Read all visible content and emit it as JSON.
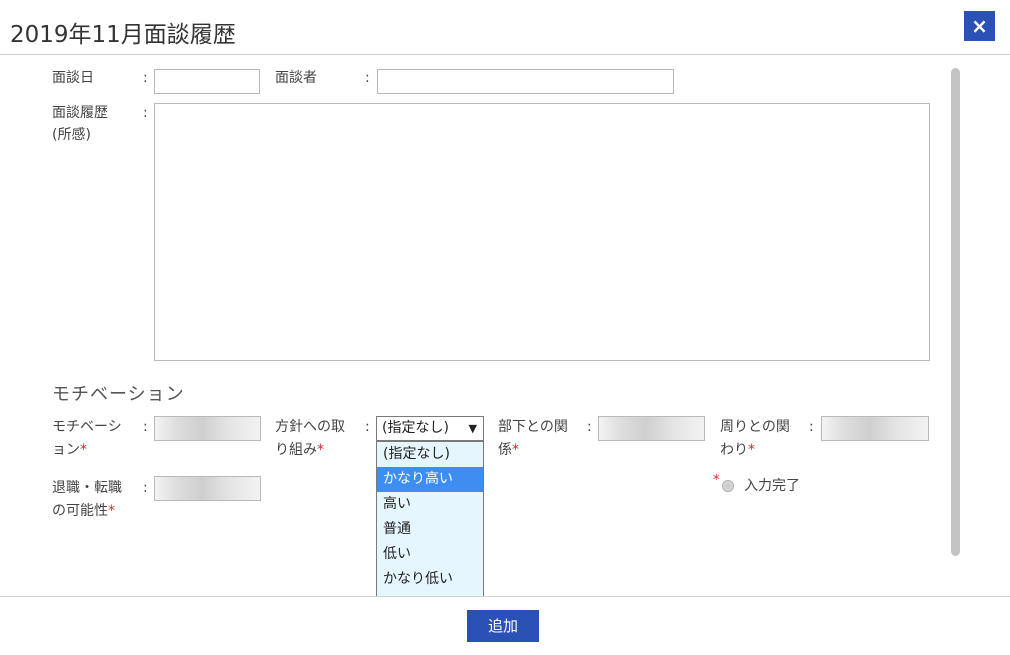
{
  "dialog": {
    "title": "2019年11月面談履歴",
    "close_symbol": "×"
  },
  "form": {
    "interview_date_label": "面談日",
    "interviewer_label": "面談者",
    "colon": ":",
    "history_label_line1": "面談履歴",
    "history_label_line2": "(所感)",
    "interview_date_value": "",
    "interviewer_value": "",
    "history_value": ""
  },
  "motivation": {
    "section_title": "モチベーション",
    "motivation_label_line1": "モチベーシ",
    "motivation_label_line2": "ョン",
    "policy_label_line1": "方針への取",
    "policy_label_line2": "り組み",
    "subordinate_label_line1": "部下との関",
    "subordinate_label_line2": "係",
    "surroundings_label_line1": "周りとの関",
    "surroundings_label_line2": "わり",
    "turnover_label_line1": "退職・転職",
    "turnover_label_line2": "の可能性",
    "required_mark": "*",
    "policy_select_value": "(指定なし)",
    "policy_select_arrow": "▼",
    "policy_options": [
      "(指定なし)",
      "かなり高い",
      "高い",
      "普通",
      "低い",
      "かなり低い"
    ],
    "highlighted_option": "かなり高い",
    "input_complete_label": "入力完了"
  },
  "footer": {
    "add_label": "追加"
  },
  "colors": {
    "accent": "#2b50b6",
    "required": "#e0242a",
    "dropdown_bg": "#e6f6ff",
    "option_highlight": "#3d8ef0"
  }
}
